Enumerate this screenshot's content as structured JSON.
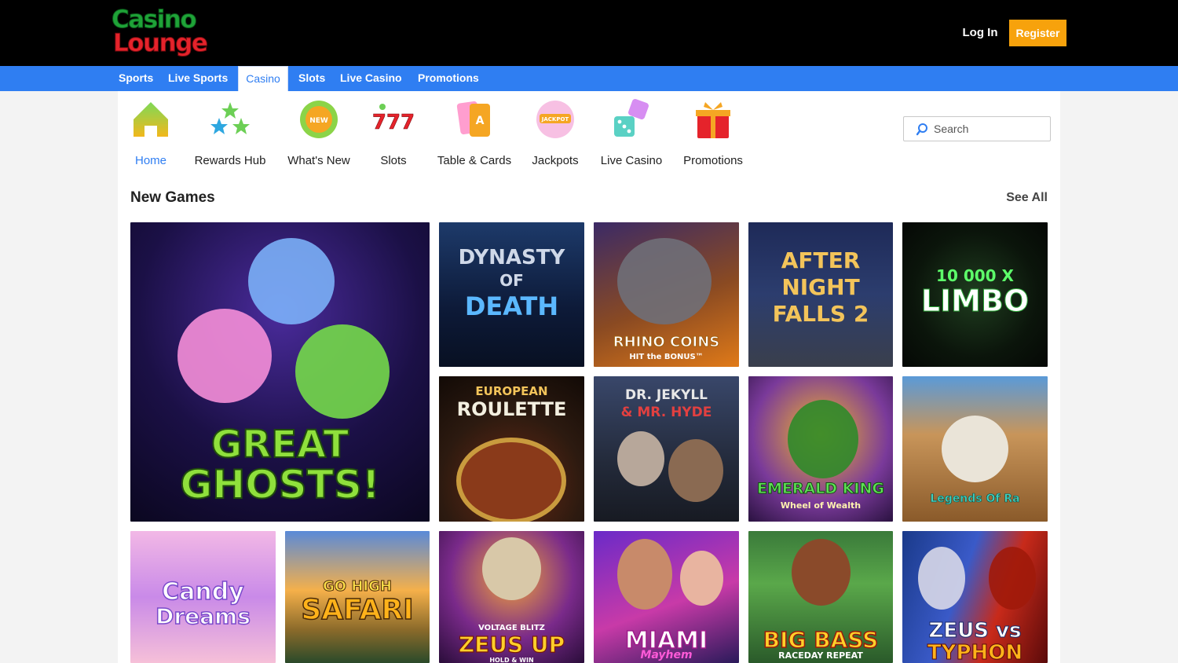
{
  "header": {
    "logo_line1": "Casino",
    "logo_line2": "Lounge",
    "login_label": "Log In",
    "register_label": "Register"
  },
  "nav": {
    "items": [
      "Sports",
      "Live Sports",
      "Casino",
      "Slots",
      "Live Casino",
      "Promotions"
    ],
    "active": "Casino"
  },
  "categories": [
    {
      "label": "Home",
      "icon": "home-icon",
      "active": true
    },
    {
      "label": "Rewards Hub",
      "icon": "stars-icon"
    },
    {
      "label": "What's New",
      "icon": "new-badge-icon",
      "badge": "NEW"
    },
    {
      "label": "Slots",
      "icon": "sevens-icon",
      "badge": "777"
    },
    {
      "label": "Table & Cards",
      "icon": "cards-icon",
      "badge": "A"
    },
    {
      "label": "Jackpots",
      "icon": "jackpot-icon",
      "badge": "JACKPOT"
    },
    {
      "label": "Live Casino",
      "icon": "dice-icon"
    },
    {
      "label": "Promotions",
      "icon": "gift-icon"
    }
  ],
  "search": {
    "placeholder": "Search"
  },
  "section": {
    "title": "New Games",
    "see_all": "See All"
  },
  "games": [
    {
      "title_l1": "GREAT",
      "title_l2": "GHOSTS!"
    },
    {
      "title_l1": "DYNASTY",
      "title_l2": "OF",
      "title_l3": "DEATH"
    },
    {
      "title_l1": "RHINO COINS",
      "title_l2": "HIT the BONUS™"
    },
    {
      "title_l1": "AFTER",
      "title_l2": "NIGHT",
      "title_l3": "FALLS 2"
    },
    {
      "title_l1": "10 000 X",
      "title_l2": "LIMBO"
    },
    {
      "title_l1": "EUROPEAN",
      "title_l2": "ROULETTE"
    },
    {
      "title_l1": "DR. JEKYLL",
      "title_l2": "& MR. HYDE"
    },
    {
      "title_l1": "EMERALD KING",
      "title_l2": "Wheel of Wealth"
    },
    {
      "title_l1": "Legends Of Ra"
    },
    {
      "title_l1": "Candy",
      "title_l2": "Dreams"
    },
    {
      "title_l1": "GO HIGH",
      "title_l2": "SAFARI"
    },
    {
      "title_l1": "VOLTAGE BLITZ",
      "title_l2": "ZEUS UP",
      "title_l3": "HOLD & WIN"
    },
    {
      "title_l1": "MIAMI",
      "title_l2": "Mayhem"
    },
    {
      "title_l1": "BIG BASS",
      "title_l2": "RACEDAY REPEAT"
    },
    {
      "title_l1": "ZEUS vs",
      "title_l2": "TYPHON"
    }
  ],
  "colors": {
    "nav_blue": "#2f7ef2",
    "register_orange": "#f7a20c",
    "header_black": "#000000"
  }
}
